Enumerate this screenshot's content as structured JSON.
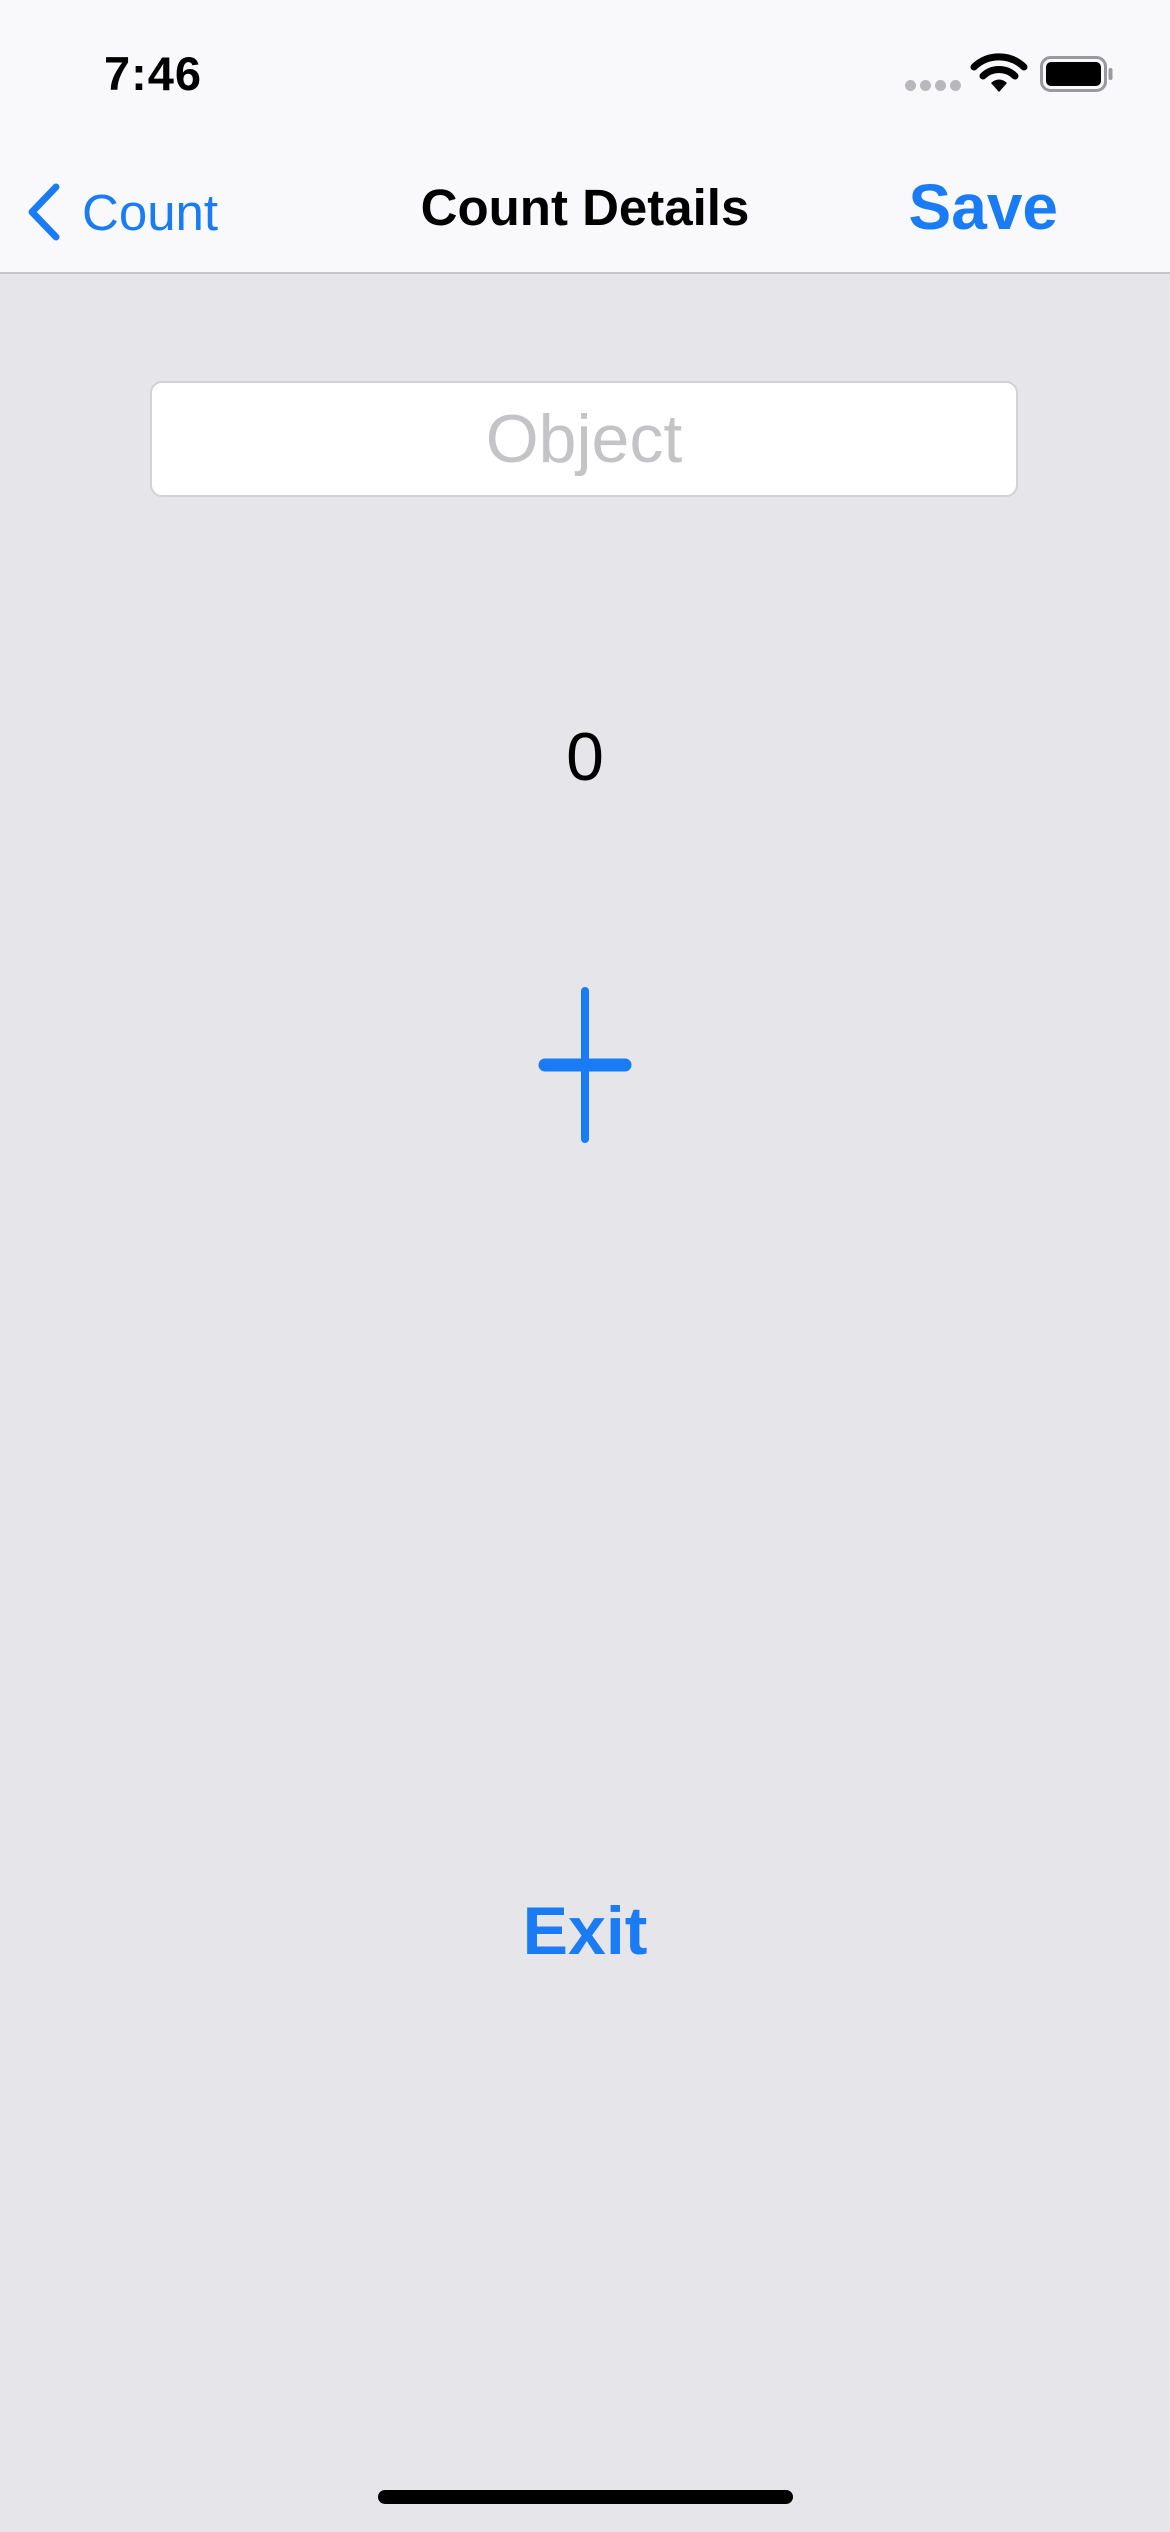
{
  "status_bar": {
    "time": "7:46",
    "icons": [
      "signal-icon",
      "wifi-icon",
      "battery-icon"
    ]
  },
  "nav": {
    "back_label": "Count",
    "title": "Count Details",
    "save_label": "Save"
  },
  "object_field": {
    "placeholder": "Object",
    "value": ""
  },
  "counter": {
    "value": "0",
    "increment_icon": "plus-icon"
  },
  "exit_label": "Exit",
  "colors": {
    "accent": "#1a7cf4",
    "background": "#e5e5ea",
    "bar_background": "#f9f9fb"
  }
}
